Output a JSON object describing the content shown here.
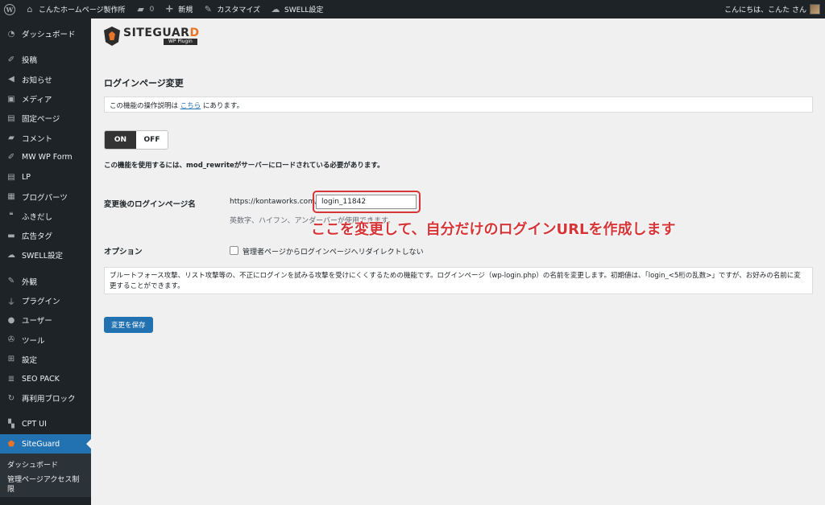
{
  "admin_bar": {
    "site_name": "こんたホームページ製作所",
    "comments_count": "0",
    "new_label": "新規",
    "customize_label": "カスタマイズ",
    "swell_label": "SWELL設定",
    "greeting": "こんにちは、こんた さん"
  },
  "sidebar": {
    "items": [
      {
        "label": "ダッシュボード",
        "icon": "gauge-icon"
      },
      {
        "label": "投稿",
        "icon": "pin-icon"
      },
      {
        "label": "お知らせ",
        "icon": "megaphone-icon"
      },
      {
        "label": "メディア",
        "icon": "media-icon"
      },
      {
        "label": "固定ページ",
        "icon": "page-icon"
      },
      {
        "label": "コメント",
        "icon": "comment-icon"
      },
      {
        "label": "MW WP Form",
        "icon": "pin-icon"
      },
      {
        "label": "LP",
        "icon": "page-icon"
      },
      {
        "label": "ブログパーツ",
        "icon": "grid-icon"
      },
      {
        "label": "ふきだし",
        "icon": "bubbles-icon"
      },
      {
        "label": "広告タグ",
        "icon": "folder-icon"
      },
      {
        "label": "SWELL設定",
        "icon": "swell-icon"
      },
      {
        "label": "外観",
        "icon": "brush-icon"
      },
      {
        "label": "プラグイン",
        "icon": "plug-icon"
      },
      {
        "label": "ユーザー",
        "icon": "user-icon"
      },
      {
        "label": "ツール",
        "icon": "wrench-icon"
      },
      {
        "label": "設定",
        "icon": "settings-icon"
      },
      {
        "label": "SEO PACK",
        "icon": "list-icon"
      },
      {
        "label": "再利用ブロック",
        "icon": "reuse-icon"
      },
      {
        "label": "CPT UI",
        "icon": "cpt-icon"
      },
      {
        "label": "SiteGuard",
        "icon": "shield-icon"
      }
    ],
    "submenu": [
      {
        "label": "ダッシュボード"
      },
      {
        "label": "管理ページアクセス制限"
      }
    ]
  },
  "plugin": {
    "logo_name": "SITEGUAR",
    "logo_accent": "D",
    "logo_sub": "WP Plugin"
  },
  "page": {
    "title": "ログインページ変更",
    "notice_prefix": "この機能の操作説明は ",
    "notice_link": "こちら",
    "notice_suffix": " にあります。",
    "toggle_on": "ON",
    "toggle_off": "OFF",
    "requirement": "この機能を使用するには、mod_rewriteがサーバーにロードされている必要があります。",
    "field_label": "変更後のログインページ名",
    "url_prefix": "https://kontaworks.com/",
    "login_value": "login_11842",
    "field_hint": "英数字、ハイフン、アンダーバーが使用できます。",
    "annotation": "ここを変更して、自分だけのログインURLを作成します",
    "option_label": "オプション",
    "option_text": "管理者ページからログインページへリダイレクトしない",
    "description": "ブルートフォース攻撃、リスト攻撃等の、不正にログインを試みる攻撃を受けにくくするための機能です。ログインページ（wp-login.php）の名前を変更します。初期値は、「login_<5桁の乱数>」ですが、お好みの名前に変更することができます。",
    "save_label": "変更を保存"
  },
  "colors": {
    "accent": "#2271b1",
    "annotation": "#d63638",
    "logo_accent": "#e8742a"
  }
}
